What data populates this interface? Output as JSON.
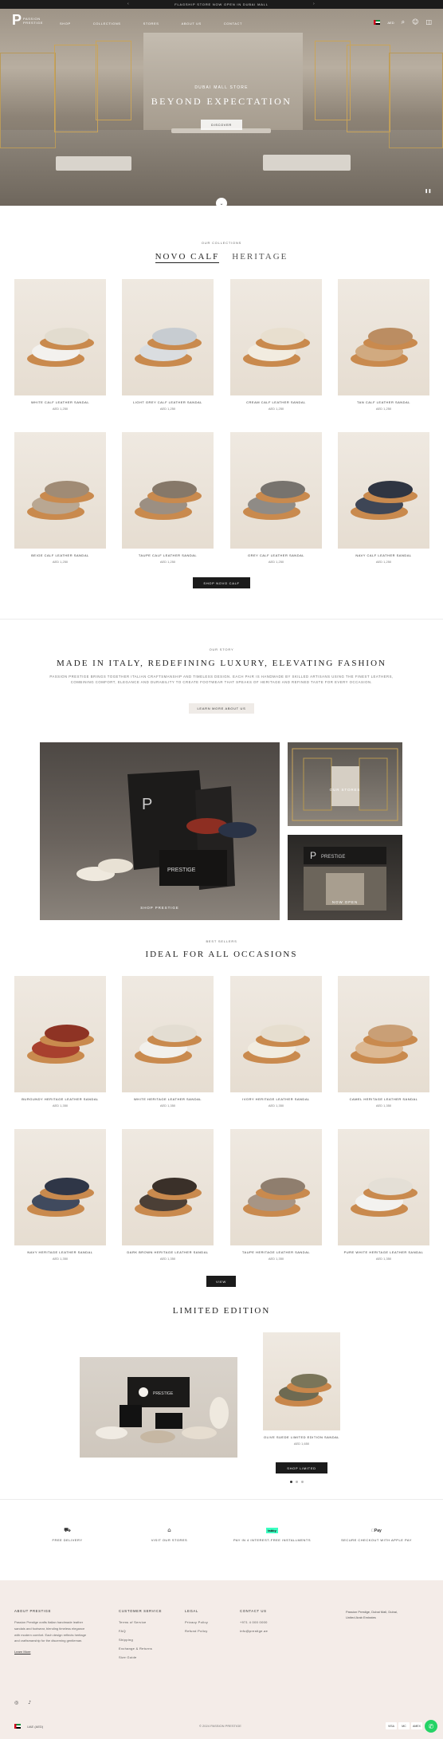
{
  "announcement": {
    "text": "FLAGSHIP STORE NOW OPEN IN DUBAI MALL"
  },
  "header": {
    "logo_mark": "P",
    "logo_text_line1": "PASSION",
    "logo_text_line2": "PRESTIGE",
    "nav": [
      "SHOP",
      "COLLECTIONS",
      "STORES",
      "ABOUT US",
      "CONTACT"
    ],
    "currency": "AED",
    "icons": [
      "flag-uae-icon",
      "search-icon",
      "account-icon",
      "cart-icon"
    ]
  },
  "hero": {
    "eyebrow": "DUBAI MALL STORE",
    "title": "BEYOND EXPECTATION",
    "button": "DISCOVER"
  },
  "section1": {
    "eyebrow": "OUR COLLECTIONS",
    "tabs": [
      "NOVO CALF",
      "HERITAGE"
    ],
    "products": [
      {
        "name": "WHITE CALF LEATHER SANDAL",
        "price": "AED 1,250"
      },
      {
        "name": "LIGHT GREY CALF LEATHER SANDAL",
        "price": "AED 1,250"
      },
      {
        "name": "CREAM CALF LEATHER SANDAL",
        "price": "AED 1,250"
      },
      {
        "name": "TAN CALF LEATHER SANDAL",
        "price": "AED 1,250"
      },
      {
        "name": "BEIGE CALF LEATHER SANDAL",
        "price": "AED 1,250"
      },
      {
        "name": "TAUPE CALF LEATHER SANDAL",
        "price": "AED 1,250"
      },
      {
        "name": "GREY CALF LEATHER SANDAL",
        "price": "AED 1,250"
      },
      {
        "name": "NAVY CALF LEATHER SANDAL",
        "price": "AED 1,250"
      }
    ],
    "button": "SHOP NOVO CALF"
  },
  "about": {
    "eyebrow": "OUR STORY",
    "title": "MADE IN ITALY, REDEFINING LUXURY, ELEVATING FASHION",
    "body": "PASSION PRESTIGE BRINGS TOGETHER ITALIAN CRAFTSMANSHIP AND TIMELESS DESIGN. EACH PAIR IS HANDMADE BY SKILLED ARTISANS USING THE FINEST LEATHERS, COMBINING COMFORT, ELEGANCE AND DURABILITY TO CREATE FOOTWEAR THAT SPEAKS OF HERITAGE AND REFINED TASTE FOR EVERY OCCASION.",
    "button": "LEARN MORE ABOUT US",
    "blocks": [
      "SHOP PRESTIGE",
      "OUR STORES",
      "NOW OPEN"
    ]
  },
  "section2": {
    "eyebrow": "BEST SELLERS",
    "title": "IDEAL FOR ALL OCCASIONS",
    "products": [
      {
        "name": "BURGUNDY HERITAGE LEATHER SANDAL",
        "price": "AED 1,350"
      },
      {
        "name": "WHITE HERITAGE LEATHER SANDAL",
        "price": "AED 1,350"
      },
      {
        "name": "IVORY HERITAGE LEATHER SANDAL",
        "price": "AED 1,350"
      },
      {
        "name": "CAMEL HERITAGE LEATHER SANDAL",
        "price": "AED 1,350"
      },
      {
        "name": "NAVY HERITAGE LEATHER SANDAL",
        "price": "AED 1,350"
      },
      {
        "name": "DARK BROWN HERITAGE LEATHER SANDAL",
        "price": "AED 1,350"
      },
      {
        "name": "TAUPE HERITAGE LEATHER SANDAL",
        "price": "AED 1,350"
      },
      {
        "name": "PURE WHITE HERITAGE LEATHER SANDAL",
        "price": "AED 1,350"
      }
    ],
    "button": "VIEW"
  },
  "limited": {
    "title": "LIMITED EDITION",
    "product_name": "OLIVE SUEDE LIMITED EDITION SANDAL",
    "price": "AED 1,650",
    "button": "SHOP LIMITED"
  },
  "features": [
    {
      "icon": "delivery-icon",
      "label": "FREE DELIVERY"
    },
    {
      "icon": "store-icon",
      "label": "VISIT OUR STORES"
    },
    {
      "icon": "tabby-icon",
      "badge": "tabby",
      "label": "PAY IN 4 INTEREST-FREE INSTALLMENTS"
    },
    {
      "icon": "apple-pay-icon",
      "badge": "Pay",
      "label": "SECURE CHECKOUT WITH APPLE PAY"
    }
  ],
  "footer": {
    "about_title": "ABOUT PRESTIGE",
    "about_text": "Passion Prestige crafts Italian handmade leather sandals and footwear, blending timeless elegance with modern comfort. Each design reflects heritage and craftsmanship for the discerning gentleman.",
    "about_link": "Learn More",
    "columns": [
      {
        "title": "CUSTOMER SERVICE",
        "links": [
          "Terms of Service",
          "FAQ",
          "Shipping",
          "Exchange & Returns",
          "Size Guide"
        ]
      },
      {
        "title": "LEGAL",
        "links": [
          "Privacy Policy",
          "Refund Policy"
        ]
      },
      {
        "title": "CONTACT US",
        "links": [
          "+971 4 000 0000",
          "info@prestige.ae"
        ]
      }
    ],
    "address": "Passion Prestige, Dubai Mall, Dubai, United Arab Emirates",
    "copyright": "© 2024 PASSION PRESTIGE",
    "region": "UAE (AED)",
    "payments": [
      "VISA",
      "MC",
      "AMEX",
      "Pay"
    ]
  },
  "colors": {
    "accent": "#1b1b1b",
    "footer_bg": "#f4ece8",
    "whatsapp": "#25d366"
  }
}
